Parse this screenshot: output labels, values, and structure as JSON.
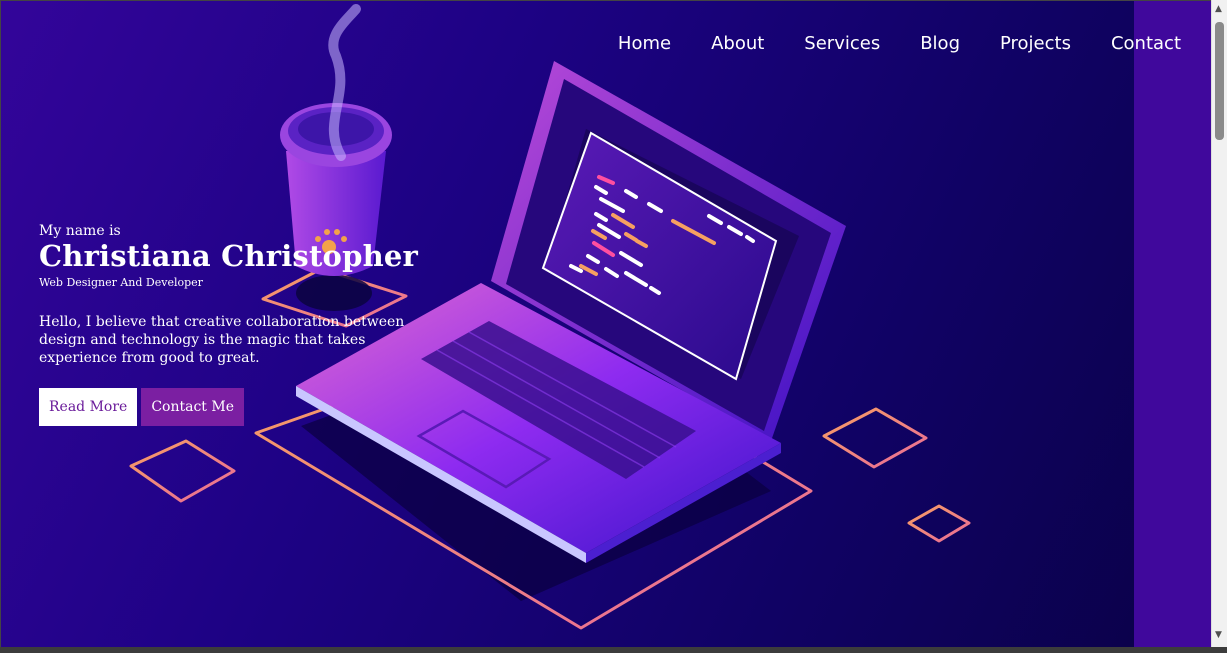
{
  "nav": {
    "items": [
      {
        "label": "Home"
      },
      {
        "label": "About"
      },
      {
        "label": "Services"
      },
      {
        "label": "Blog"
      },
      {
        "label": "Projects"
      },
      {
        "label": "Contact"
      }
    ]
  },
  "hero": {
    "eyebrow": "My name is",
    "name": "Christiana Christopher",
    "role": "Web Designer And Developer",
    "bio": "Hello, I believe that creative collaboration between design and technology is the magic that takes experience from good to great.",
    "buttons": {
      "read_more": "Read More",
      "contact_me": "Contact Me"
    }
  },
  "colors": {
    "accent": "#7b1fa2",
    "background_dark": "#100264",
    "neon_outline": "#f08a7a"
  },
  "icons": {
    "scroll_up": "scroll-up-arrow-icon",
    "scroll_down": "scroll-down-arrow-icon"
  }
}
